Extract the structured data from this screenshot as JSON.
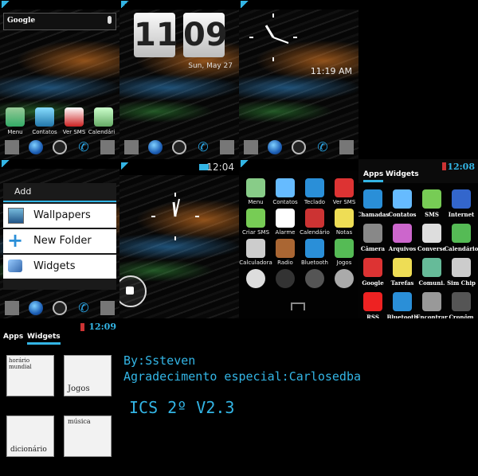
{
  "panel1": {
    "search_text": "Google",
    "apps": [
      "Menu",
      "Contatos",
      "Ver SMS",
      "Calendári"
    ]
  },
  "panel2": {
    "clock_hour": "11",
    "clock_minute": "09",
    "date": "Sun, May 27"
  },
  "panel3": {
    "lock_time": "11:19 AM"
  },
  "panel4": {
    "menu_title": "Add",
    "menu_items": [
      "Wallpapers",
      "New Folder",
      "Widgets"
    ]
  },
  "panel5": {
    "status_time": "12:04"
  },
  "panel6": {
    "apps": [
      "Menu",
      "Contatos",
      "Teclado",
      "Ver SMS",
      "Criar SMS",
      "Alarme",
      "Calendário",
      "Notas",
      "Calculadora",
      "Radio",
      "Bluetooth",
      "Jogos"
    ]
  },
  "panel7": {
    "tabs": [
      "Apps",
      "Widgets"
    ],
    "status_time": "12:08",
    "apps": [
      "Chamadas",
      "Contatos",
      "SMS",
      "Internet",
      "Câmera",
      "Arquivos",
      "Converse",
      "Calendário",
      "Google",
      "Tarefas",
      "Comuni.",
      "Sim Chip",
      "RSS",
      "Bluetooth",
      "Encontrar",
      "Cronôm"
    ]
  },
  "panel8": {
    "tabs": [
      "Apps",
      "Widgets"
    ],
    "status_time": "12:09",
    "widgets": [
      "horário mundial",
      "Jogos",
      "dicionário",
      "música"
    ]
  },
  "credits": {
    "author": "By:Ssteven",
    "thanks": "Agradecimento especial:Carlosedba",
    "version": "ICS 2º V2.3"
  },
  "colors": {
    "accent": "#33b5e5"
  }
}
